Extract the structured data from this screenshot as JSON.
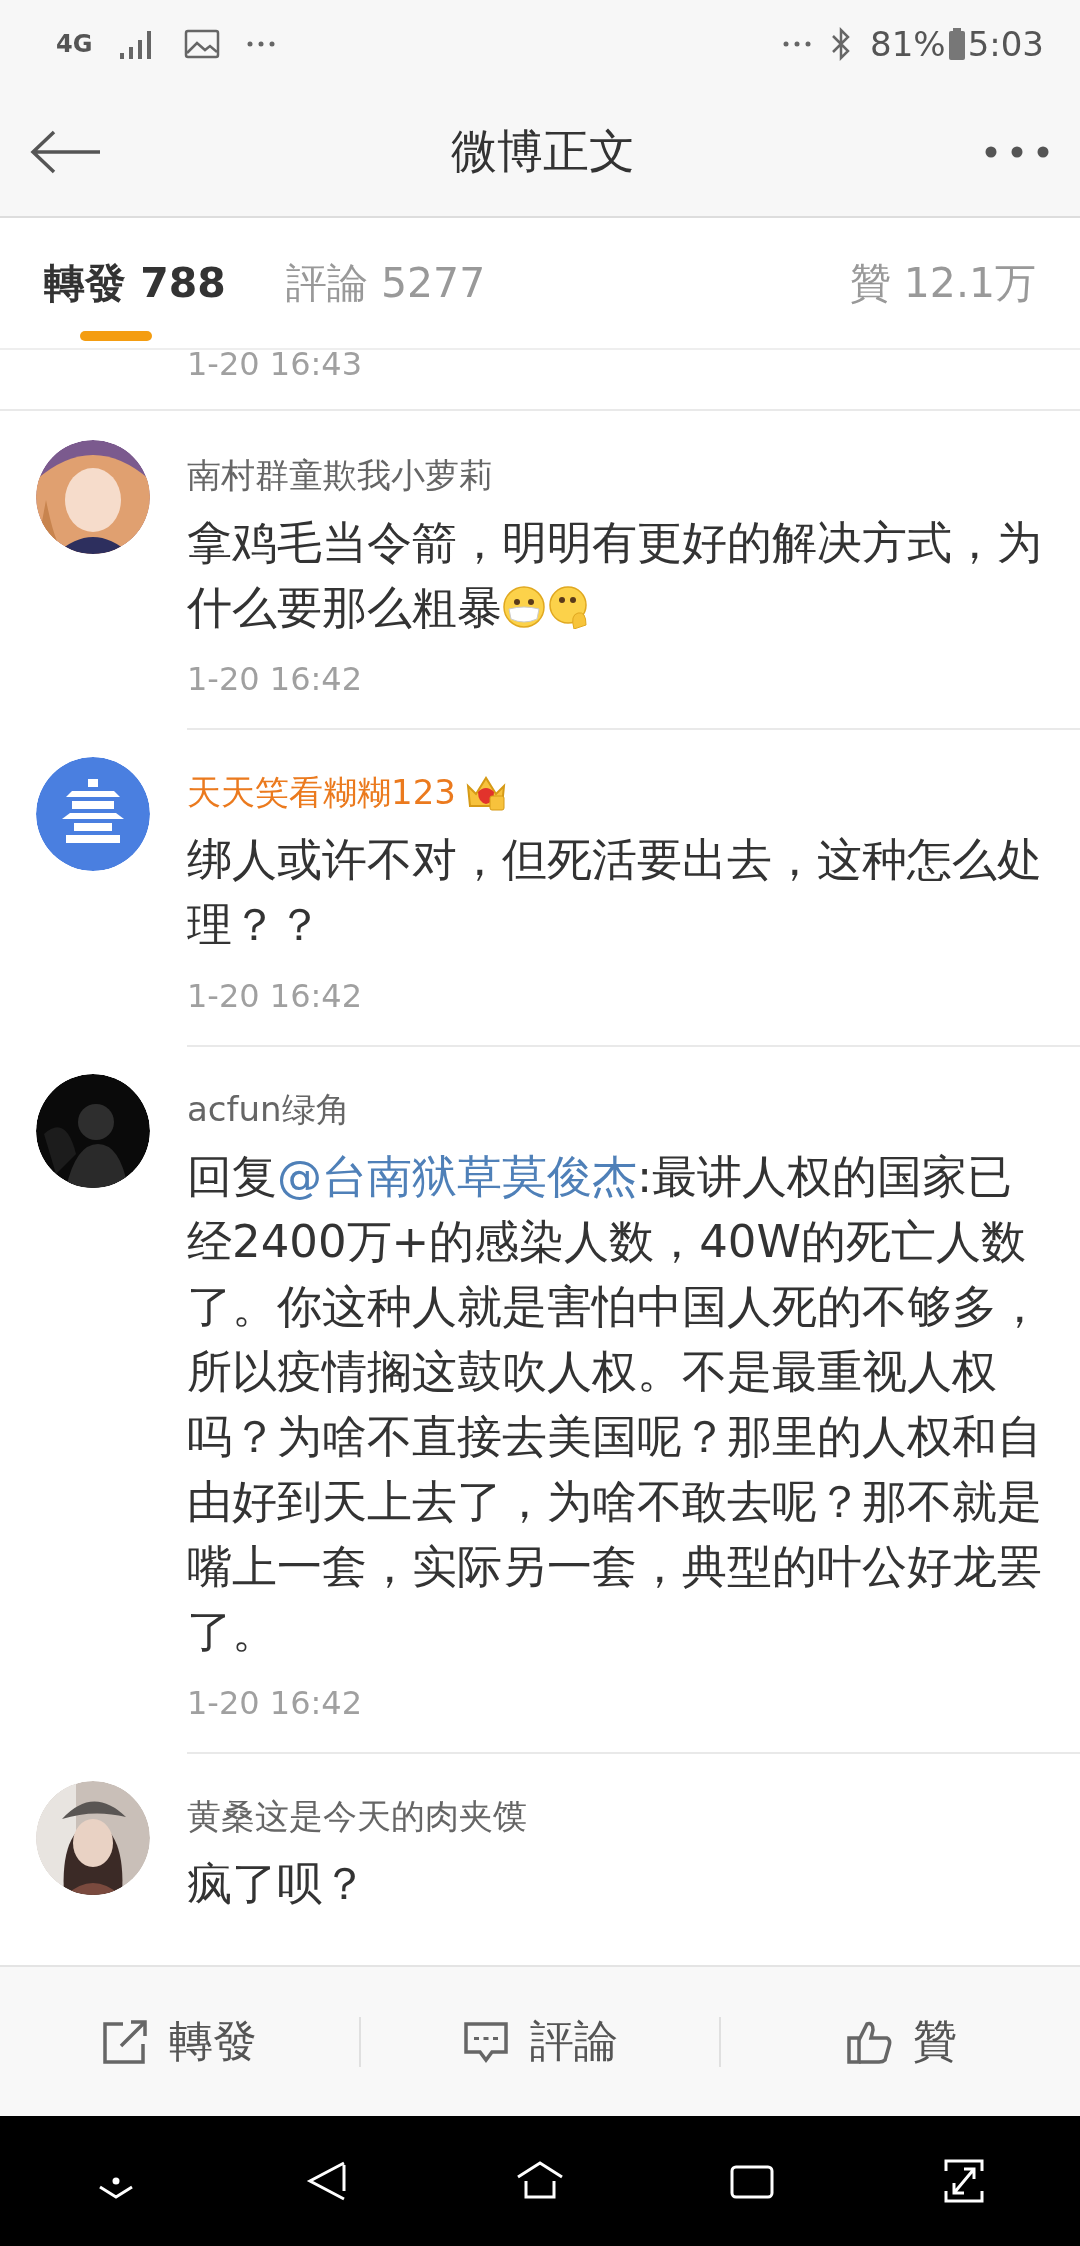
{
  "status_bar": {
    "network": "4G",
    "battery": "81%",
    "time": "5:03"
  },
  "header": {
    "title": "微博正文"
  },
  "tabs": [
    {
      "label": "轉發",
      "count": "788",
      "selected": true
    },
    {
      "label": "評論",
      "count": "5277",
      "selected": false
    },
    {
      "label": "贊",
      "count": "12.1万",
      "selected": false
    }
  ],
  "previous_timestamp": "1-20 16:43",
  "comments": [
    {
      "avatar": {
        "kind": "picture"
      },
      "name": "南村群童欺我小萝莉",
      "vip": false,
      "body": [
        {
          "kind": "text",
          "text": "拿鸡毛当令箭，明明有更好的解决方式，为什么要那么粗暴"
        },
        {
          "kind": "mask-emoji"
        },
        {
          "kind": "thinking-emoji"
        }
      ],
      "time": "1-20 16:42"
    },
    {
      "avatar": {
        "kind": "picture"
      },
      "name": "天天笑看糊糊123",
      "vip": true,
      "body": [
        {
          "kind": "text",
          "text": "绑人或许不对，但死活要出去，这种怎么处理？？"
        }
      ],
      "time": "1-20 16:42"
    },
    {
      "avatar": {
        "kind": "picture"
      },
      "name": "acfun绿角",
      "vip": false,
      "body": [
        {
          "kind": "text",
          "text": "回复"
        },
        {
          "kind": "mention",
          "text": "@台南狱草莫俊杰"
        },
        {
          "kind": "text",
          "text": ":最讲人权的国家已经2400万+的感染人数，40W的死亡人数了。你这种人就是害怕中国人死的不够多，所以疫情搁这鼓吹人权。不是最重视人权吗？为啥不直接去美国呢？那里的人权和自由好到天上去了，为啥不敢去呢？那不就是嘴上一套，实际另一套，典型的叶公好龙罢了。"
        }
      ],
      "time": "1-20 16:42"
    },
    {
      "avatar": {
        "kind": "picture"
      },
      "name": "黄桑这是今天的肉夹馍",
      "vip": false,
      "body": [
        {
          "kind": "text",
          "text": "疯了呗？"
        }
      ]
    }
  ],
  "actions": [
    {
      "kind": "repost",
      "label": "轉發"
    },
    {
      "kind": "comment",
      "label": "評論"
    },
    {
      "kind": "like",
      "label": "贊"
    }
  ]
}
